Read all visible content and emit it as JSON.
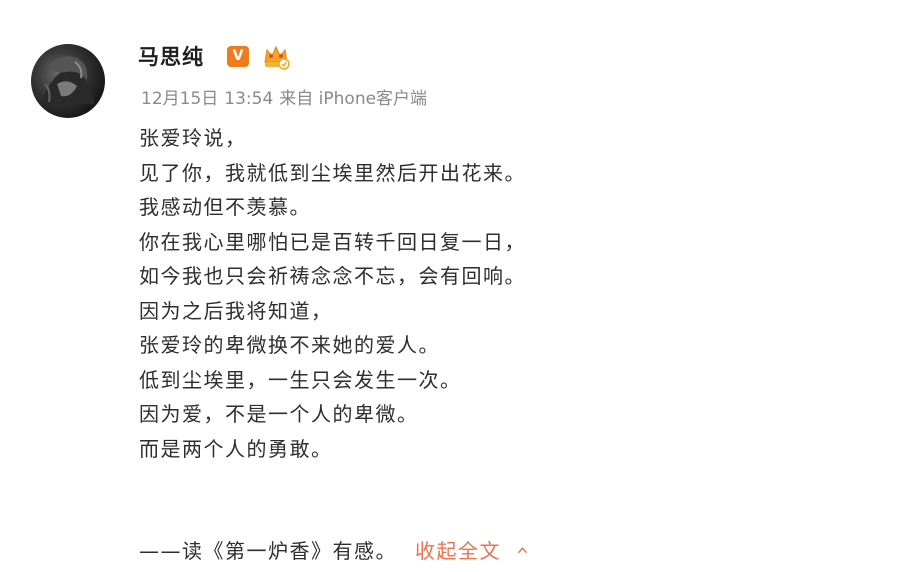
{
  "post": {
    "author": "马思纯",
    "verified_badge": "V",
    "verified_color": "#f07a1e",
    "level_icon": "crown-icon",
    "meta": {
      "date": "12月15日",
      "time": "13:54",
      "source": "来自 iPhone客户端"
    },
    "lines": [
      "张爱玲说，",
      "见了你，我就低到尘埃里然后开出花来。",
      "我感动但不羡慕。",
      "你在我心里哪怕已是百转千回日复一日，",
      "如今我也只会祈祷念念不忘，会有回响。",
      "因为之后我将知道，",
      "张爱玲的卑微换不来她的爱人。",
      "低到尘埃里，一生只会发生一次。",
      "因为爱，不是一个人的卑微。",
      "而是两个人的勇敢。"
    ],
    "last_line": "——读《第一炉香》有感。",
    "collapse_label": "收起全文",
    "link_color": "#eb7350"
  }
}
